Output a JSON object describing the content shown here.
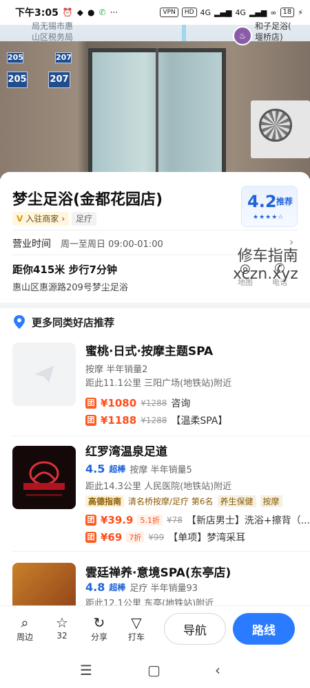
{
  "status_bar": {
    "time": "下午3:05",
    "icons": [
      "alarm-icon",
      "qq-icon",
      "penguin-icon",
      "phone-icon"
    ],
    "more": "···",
    "vpn": "VPN",
    "hd": "HD",
    "signal1": "4G",
    "signal2": "4G",
    "battery": "18"
  },
  "map": {
    "label_left": "局无锡市惠\n山区税务局",
    "label_right": "和子足浴(\n堰桥店)"
  },
  "photo": {
    "plates": [
      "205",
      "207",
      "205",
      "207"
    ]
  },
  "store": {
    "name": "梦尘足浴(金都花园店)",
    "merchant_tag": "入驻商家",
    "category": "足疗",
    "rating": "4.2",
    "rating_label": "推荐",
    "hours_label": "营业时间",
    "hours_value": "周一至周日 09:00-01:00",
    "distance": "距你415米  步行7分钟",
    "address": "惠山区惠源路209号梦尘足浴",
    "action_map": "地图",
    "action_call": "电话"
  },
  "watermark": {
    "line1": "修车指南",
    "line2": "xczn.xyz"
  },
  "recommend": {
    "title": "更多同类好店推荐",
    "shops": [
      {
        "name": "蜜桃·日式·按摩主题SPA",
        "meta": "按摩  半年销量2",
        "location": "距此11.1公里   三阳广场(地铁站)附近",
        "deals": [
          {
            "tag": "团",
            "price": "¥1080",
            "orig": "¥1288",
            "text": "咨询"
          },
          {
            "tag": "团",
            "price": "¥1188",
            "orig": "¥1288",
            "text": "【温柔SPA】"
          }
        ]
      },
      {
        "name": "红罗湾温泉足道",
        "score": "4.5",
        "score_label": "超棒",
        "meta": "按摩  半年销量5",
        "location": "距此14.3公里   人民医院(地铁站)附近",
        "guide": [
          "高德指南",
          "清名桥按摩/足疗 第6名",
          "养生保健",
          "按摩"
        ],
        "deals": [
          {
            "tag": "团",
            "price": "¥39.9",
            "disc": "5.1折",
            "orig": "¥78",
            "text": "【新店男士】洗浴+擦背（..."
          },
          {
            "tag": "团",
            "price": "¥69",
            "disc": "7折",
            "orig": "¥99",
            "text": "【单项】梦湾采耳"
          }
        ]
      },
      {
        "name": "雲廷禅养·意境SPA(东亭店)",
        "score": "4.8",
        "score_label": "超棒",
        "meta": "足疗  半年销量93",
        "location": "距此12.1公里   东亭(地铁站)附近"
      }
    ]
  },
  "bottom_bar": {
    "nearby": "周边",
    "favorites": "32",
    "share": "分享",
    "taxi": "打车",
    "navigate": "导航",
    "route": "路线"
  },
  "colors": {
    "accent": "#2a7bff",
    "rating_blue": "#1e63d8",
    "price_orange": "#ff4d1a"
  }
}
